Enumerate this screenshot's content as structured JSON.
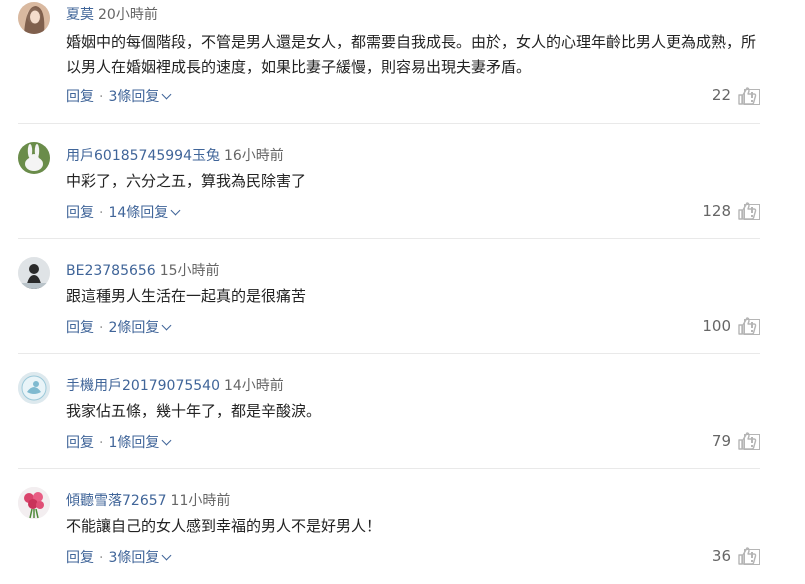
{
  "comments": [
    {
      "user": "夏莫",
      "time": "20小時前",
      "text": "婚姻中的每個階段，不管是男人還是女人，都需要自我成長。由於，女人的心理年齡比男人更為成熟，所以男人在婚姻裡成長的速度，如果比妻子緩慢，則容易出現夫妻矛盾。",
      "reply_label": "回复",
      "replies_label": "3條回复",
      "likes": "22",
      "avatar_icon": "woman-portrait-icon"
    },
    {
      "user": "用戶60185745994玉兔",
      "time": "16小時前",
      "text": "中彩了，六分之五，算我為民除害了",
      "reply_label": "回复",
      "replies_label": "14條回复",
      "likes": "128",
      "avatar_icon": "rabbit-icon"
    },
    {
      "user": "BE23785656",
      "time": "15小時前",
      "text": "跟這種男人生活在一起真的是很痛苦",
      "reply_label": "回复",
      "replies_label": "2條回复",
      "likes": "100",
      "avatar_icon": "person-silhouette-icon"
    },
    {
      "user": "手機用戶20179075540",
      "time": "14小時前",
      "text": "我家佔五條，幾十年了，都是辛酸淚。",
      "reply_label": "回复",
      "replies_label": "1條回复",
      "likes": "79",
      "avatar_icon": "default-user-icon"
    },
    {
      "user": "傾聽雪落72657",
      "time": "11小時前",
      "text": "不能讓自己的女人感到幸福的男人不是好男人！",
      "reply_label": "回复",
      "replies_label": "3條回复",
      "likes": "36",
      "avatar_icon": "flowers-icon"
    }
  ],
  "colors": {
    "link": "#406599",
    "text": "#222222",
    "muted": "#666666",
    "icon": "#b5b5b5"
  }
}
